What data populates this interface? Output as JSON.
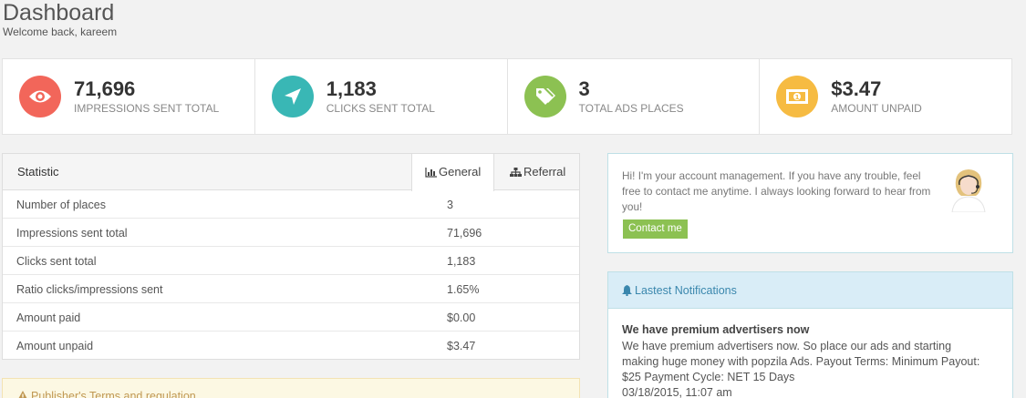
{
  "header": {
    "title": "Dashboard",
    "subtitle": "Welcome back, kareem"
  },
  "stats": [
    {
      "value": "71,696",
      "label": "IMPRESSIONS SENT TOTAL",
      "color": "#f2665a",
      "icon": "eye-icon"
    },
    {
      "value": "1,183",
      "label": "CLICKS SENT TOTAL",
      "color": "#39b7b5",
      "icon": "location-arrow-icon"
    },
    {
      "value": "3",
      "label": "TOTAL ADS PLACES",
      "color": "#8cc152",
      "icon": "tags-icon"
    },
    {
      "value": "$3.47",
      "label": "AMOUNT UNPAID",
      "color": "#f6bb42",
      "icon": "money-icon"
    }
  ],
  "statistic": {
    "title": "Statistic",
    "tabs": [
      "General",
      "Referral"
    ],
    "rows": [
      {
        "key": "Number of places",
        "value": "3"
      },
      {
        "key": "Impressions sent total",
        "value": "71,696"
      },
      {
        "key": "Clicks sent total",
        "value": "1,183"
      },
      {
        "key": "Ratio clicks/impressions sent",
        "value": "1.65%"
      },
      {
        "key": "Amount paid",
        "value": "$0.00"
      },
      {
        "key": "Amount unpaid",
        "value": "$3.47"
      }
    ]
  },
  "terms": {
    "title": "Publisher's Terms and regulation"
  },
  "manager": {
    "message": "Hi! I'm your account management. If you have any trouble, feel free to contact me anytime. I always looking forward to hear from you!",
    "button": "Contact me"
  },
  "notifications": {
    "title": "Lastest Notifications",
    "items": [
      {
        "heading": "We have premium advertisers now",
        "body": "We have premium advertisers now. So place our ads and starting making huge money with popzila Ads. Payout Terms: Minimum Payout: $25 Payment Cycle: NET 15 Days",
        "date": "03/18/2015, 11:07 am"
      }
    ]
  }
}
